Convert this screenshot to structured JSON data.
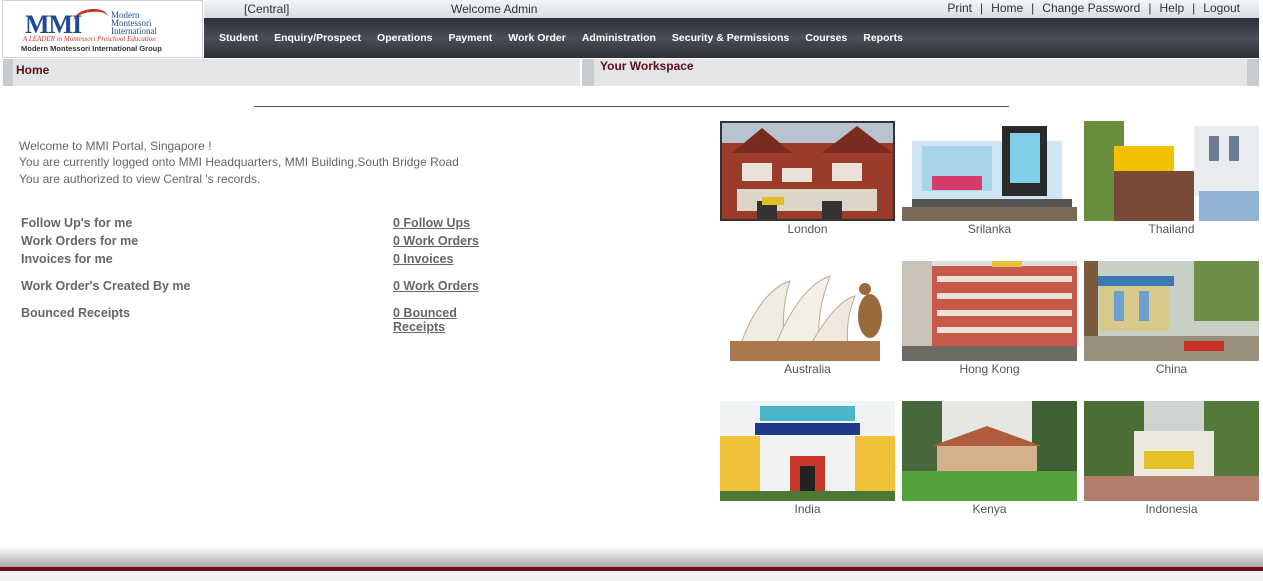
{
  "logo": {
    "name": "MMI",
    "words": [
      "Modern",
      "Montessori",
      "International"
    ],
    "tagline": "A LEADER in Montessori Preschool Education",
    "group": "Modern Montessori International Group"
  },
  "topbar": {
    "region": "[Central]",
    "welcome": "Welcome Admin",
    "links": [
      "Print",
      "Home",
      "Change Password",
      "Help",
      "Logout"
    ]
  },
  "menu": [
    "Student",
    "Enquiry/Prospect",
    "Operations",
    "Payment",
    "Work Order",
    "Administration",
    "Security & Permissions",
    "Courses",
    "Reports"
  ],
  "home_title": "Home",
  "workspace_title": "Your Workspace",
  "welcome_lines": [
    "Welcome to MMI Portal, Singapore !",
    "You are currently logged onto MMI Headquarters, MMI Building,South Bridge Road",
    "You are authorized to view Central 's records."
  ],
  "summary": [
    {
      "label": "Follow Up's for me",
      "link": "0 Follow Ups"
    },
    {
      "label": "Work Orders for me",
      "link": "0 Work Orders"
    },
    {
      "label": "Invoices for me",
      "link": "0 Invoices"
    },
    {
      "label": "Work Order's Created By me",
      "link": "0 Work Orders"
    },
    {
      "label": "Bounced Receipts",
      "link": "0 Bounced Receipts"
    }
  ],
  "gallery": [
    "London",
    "Srilanka",
    "Thailand",
    "Australia",
    "Hong Kong",
    "China",
    "India",
    "Kenya",
    "Indonesia"
  ],
  "colors": {
    "menu_bg": "#3a3d44",
    "title_text": "#5a0f1a",
    "footer_red": "#6b0d12"
  }
}
